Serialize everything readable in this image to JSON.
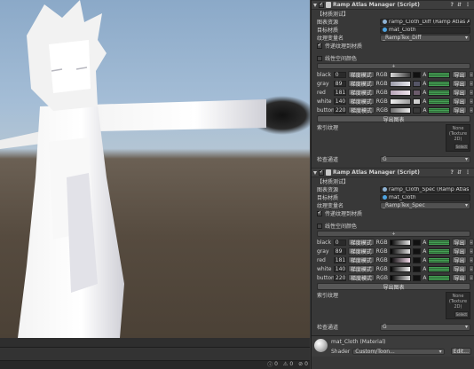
{
  "scene": {
    "console_counts": [
      "0",
      "0",
      "0"
    ]
  },
  "inspector": {
    "components": [
      {
        "title": "Ramp Atlas Manager (Script)",
        "material_test": "【材质测试】",
        "fields": [
          {
            "label": "图表资源",
            "value": "ramp_Cloth_Diff (Ramp Atlas As",
            "icon": "atlas-asset-icon"
          },
          {
            "label": "目标材质",
            "value": "mat_Cloth",
            "icon": "material-icon"
          },
          {
            "label": "纹理变量名",
            "value": "_RampTex_Diff",
            "type": "dropdown"
          }
        ],
        "pass_texture": "传递纹理到材质",
        "linear_color": "线性空间颜色",
        "gradients": [
          {
            "name": "black",
            "value": "0",
            "mode": "梯度模式",
            "channel": "RGB",
            "from": "#d8d8d8",
            "to": "#3a3a3a",
            "tail": "#111111"
          },
          {
            "name": "gray",
            "value": "89",
            "mode": "梯度模式",
            "channel": "RGB",
            "from": "#9a9aa8",
            "to": "#e8e8ee",
            "tail": "#555566"
          },
          {
            "name": "red",
            "value": "181",
            "mode": "梯度模式",
            "channel": "RGB",
            "from": "#b8a4b8",
            "to": "#f0e6ee",
            "tail": "#6b5b6b"
          },
          {
            "name": "white",
            "value": "140",
            "mode": "梯度模式",
            "channel": "RGB",
            "from": "#eeeeee",
            "to": "#9c9c9c",
            "tail": "#cfcfcf"
          },
          {
            "name": "button",
            "value": "220",
            "mode": "梯度模式",
            "channel": "RGB",
            "from": "#6b6b6b",
            "to": "#e8e8e8",
            "tail": "#3a3a3a"
          }
        ],
        "alpha_label": "A",
        "export_label": "导出",
        "export_chart": "导出图表",
        "index_texture": "索引纹理",
        "texture_none": "None",
        "texture_type": "(Texture 2D)",
        "select_label": "Select",
        "check_channel": "检查通道",
        "channel_value": "G"
      },
      {
        "title": "Ramp Atlas Manager (Script)",
        "material_test": "【材质测试】",
        "fields": [
          {
            "label": "图表资源",
            "value": "ramp_Cloth_Spec (Ramp Atlas A",
            "icon": "atlas-asset-icon"
          },
          {
            "label": "目标材质",
            "value": "mat_Cloth",
            "icon": "material-icon"
          },
          {
            "label": "纹理变量名",
            "value": "_RampTex_Spec",
            "type": "dropdown"
          }
        ],
        "pass_texture": "传递纹理到材质",
        "linear_color": "线性空间颜色",
        "gradients": [
          {
            "name": "black",
            "value": "0",
            "mode": "梯度模式",
            "channel": "RGB",
            "from": "#000000",
            "to": "#e8e8e8",
            "tail": "#111111"
          },
          {
            "name": "gray",
            "value": "89",
            "mode": "梯度模式",
            "channel": "RGB",
            "from": "#000000",
            "to": "#e0e0e0",
            "tail": "#111111"
          },
          {
            "name": "red",
            "value": "181",
            "mode": "梯度模式",
            "channel": "RGB",
            "from": "#000000",
            "to": "#f0d8e8",
            "tail": "#111111"
          },
          {
            "name": "white",
            "value": "140",
            "mode": "梯度模式",
            "channel": "RGB",
            "from": "#000000",
            "to": "#f4f4f4",
            "tail": "#111111"
          },
          {
            "name": "button",
            "value": "220",
            "mode": "梯度模式",
            "channel": "RGB",
            "from": "#000000",
            "to": "#d8d8d8",
            "tail": "#111111"
          }
        ],
        "alpha_label": "A",
        "export_label": "导出",
        "export_chart": "导出图表",
        "index_texture": "索引纹理",
        "texture_none": "None",
        "texture_type": "(Texture 2D)",
        "select_label": "Select",
        "check_channel": "检查通道",
        "channel_value": "G"
      }
    ],
    "material": {
      "title": "mat_Cloth (Material)",
      "shader_label": "Shader",
      "shader_value": "Custom/Toon...",
      "edit_label": "Edit..."
    }
  },
  "colors": {
    "panel_bg": "#383838",
    "field_bg": "#2a2a2a",
    "accent_green": "#45a055"
  }
}
